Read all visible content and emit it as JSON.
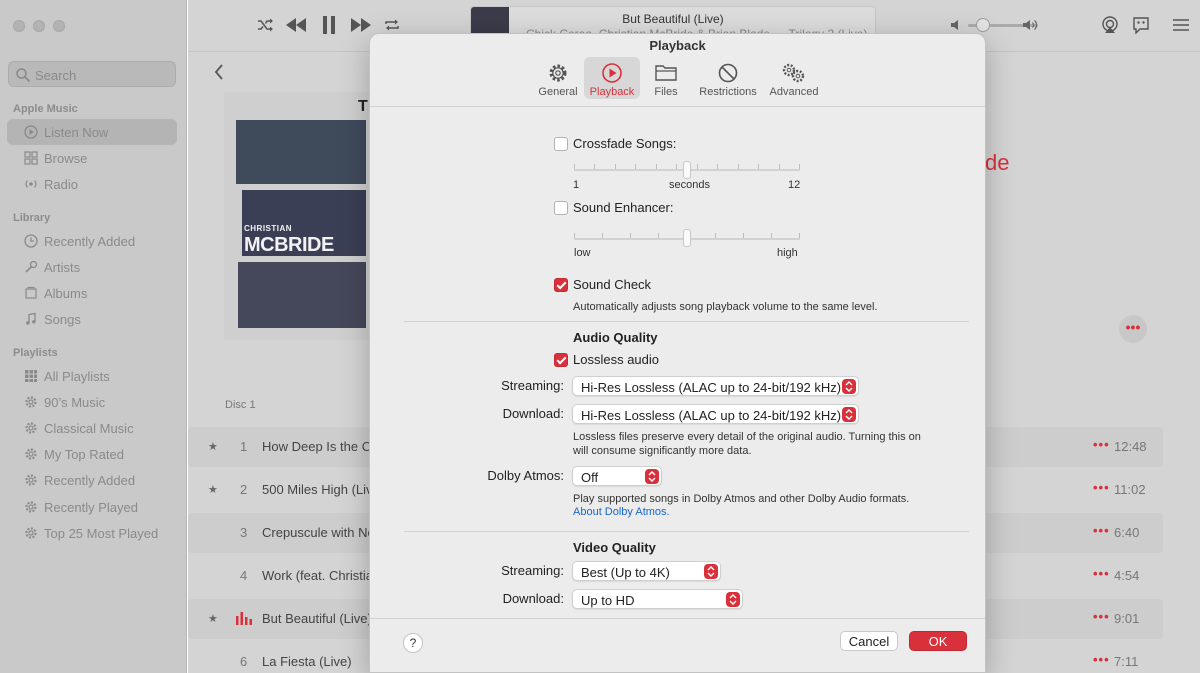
{
  "sidebar": {
    "search_placeholder": "Search",
    "sections": {
      "apple_music": "Apple Music",
      "library": "Library",
      "playlists": "Playlists"
    },
    "apple_music_items": [
      "Listen Now",
      "Browse",
      "Radio"
    ],
    "library_items": [
      "Recently Added",
      "Artists",
      "Albums",
      "Songs"
    ],
    "playlist_items": [
      "All Playlists",
      "90’s Music",
      "Classical Music",
      "My Top Rated",
      "Recently Added",
      "Recently Played",
      "Top 25 Most Played"
    ]
  },
  "now_playing": {
    "title": "But Beautiful (Live)",
    "subtitle": "Chick Corea, Christian McBride & Brian Blade — Trilogy 2 (Live)"
  },
  "album": {
    "cover_text": "CHRISTIAN\nMCBRIDE",
    "cover_line1": "CHRISTIAN",
    "cover_line2": "MCBRIDE",
    "cover_corner": "T",
    "title_fragment": "de",
    "disc_label": "Disc 1"
  },
  "tracks": [
    {
      "star": "★",
      "num": "1",
      "title": "How Deep Is the O",
      "dots": "•••",
      "duration": "12:48"
    },
    {
      "star": "★",
      "num": "2",
      "title": "500 Miles High (Liv",
      "dots": "•••",
      "duration": "11:02"
    },
    {
      "star": "",
      "num": "3",
      "title": "Crepuscule with Ne",
      "dots": "•••",
      "duration": "6:40"
    },
    {
      "star": "",
      "num": "4",
      "title": "Work (feat. Christia",
      "dots": "•••",
      "duration": "4:54"
    },
    {
      "star": "★",
      "num": "",
      "title": "But Beautiful (Live)",
      "dots": "•••",
      "duration": "9:01"
    },
    {
      "star": "",
      "num": "6",
      "title": "La Fiesta (Live)",
      "dots": "•••",
      "duration": "7:11"
    }
  ],
  "prefs": {
    "title": "Playback",
    "tabs": [
      "General",
      "Playback",
      "Files",
      "Restrictions",
      "Advanced"
    ],
    "active_tab": "Playback",
    "crossfade": {
      "label": "Crossfade Songs:",
      "checked": false,
      "min": "1",
      "unit": "seconds",
      "max": "12"
    },
    "enhancer": {
      "label": "Sound Enhancer:",
      "checked": false,
      "min": "low",
      "max": "high"
    },
    "sound_check": {
      "label": "Sound Check",
      "checked": true,
      "description": "Automatically adjusts song playback volume to the same level."
    },
    "audio_quality": {
      "heading": "Audio Quality",
      "lossless_label": "Lossless audio",
      "lossless_checked": true,
      "streaming_label": "Streaming:",
      "streaming_value": "Hi-Res Lossless (ALAC up to 24-bit/192 kHz)",
      "download_label": "Download:",
      "download_value": "Hi-Res Lossless (ALAC up to 24-bit/192 kHz)",
      "note_line1": "Lossless files preserve every detail of the original audio. Turning this on",
      "note_line2": "will consume significantly more data.",
      "dolby_label": "Dolby Atmos:",
      "dolby_value": "Off",
      "dolby_note": "Play supported songs in Dolby Atmos and other Dolby Audio formats.",
      "dolby_link": "About Dolby Atmos."
    },
    "video_quality": {
      "heading": "Video Quality",
      "streaming_label": "Streaming:",
      "streaming_value": "Best (Up to 4K)",
      "download_label": "Download:",
      "download_value": "Up to HD"
    },
    "buttons": {
      "help": "?",
      "cancel": "Cancel",
      "ok": "OK"
    }
  },
  "colors": {
    "accent": "#d9313b",
    "link": "#1767cf",
    "sheet_bg": "#ececec"
  }
}
